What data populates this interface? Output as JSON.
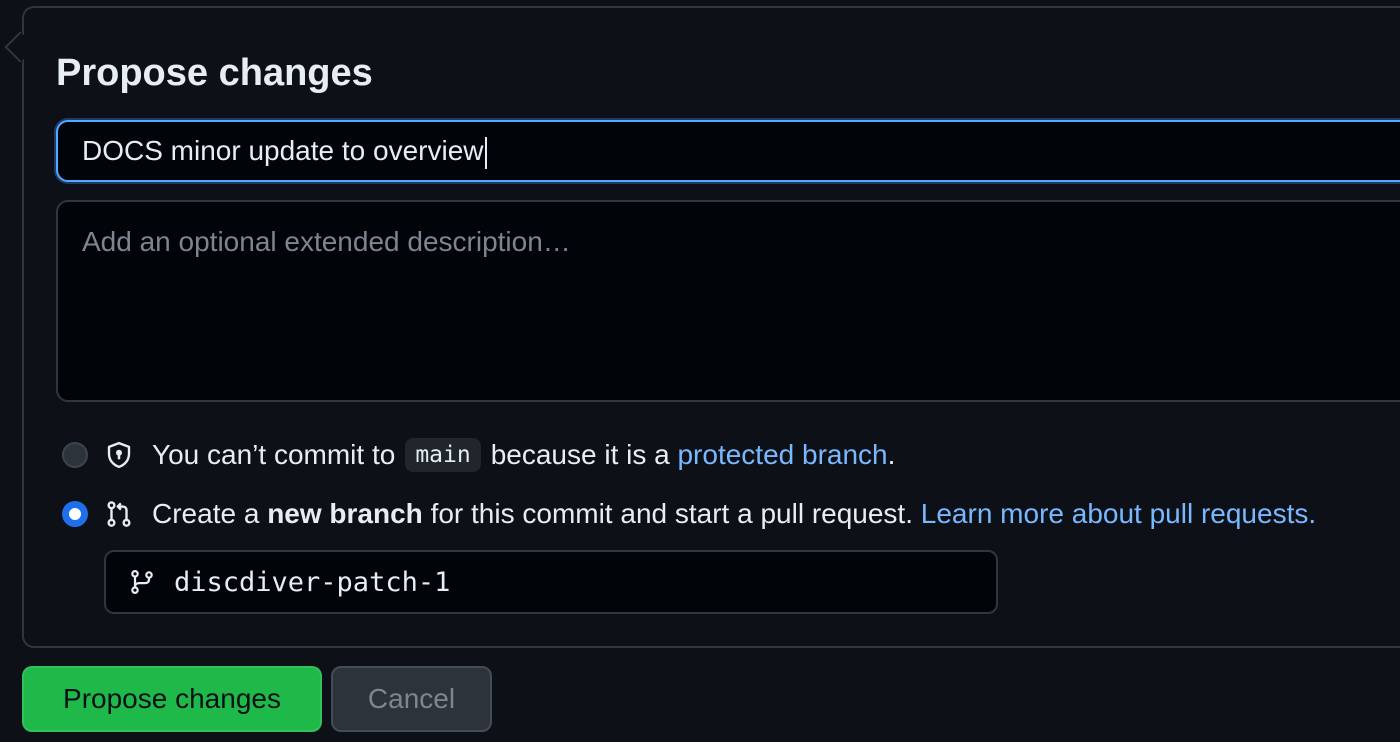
{
  "title": "Propose changes",
  "summary_input": {
    "value": "DOCS minor update to overview"
  },
  "description_input": {
    "placeholder": "Add an optional extended description…"
  },
  "options": {
    "direct_commit": {
      "text_before": "You can’t commit to",
      "branch": "main",
      "text_after": "because it is a",
      "link": "protected branch",
      "end": ".",
      "icon": "shield-lock-icon",
      "selected": false,
      "disabled": true
    },
    "new_branch": {
      "text_before": "Create a",
      "bold": "new branch",
      "text_after": "for this commit and start a pull request.",
      "link": "Learn more about pull requests.",
      "icon": "git-pull-request-icon",
      "selected": true
    }
  },
  "branch_name_input": {
    "value": "discdiver-patch-1",
    "icon": "git-branch-icon"
  },
  "buttons": {
    "propose": "Propose changes",
    "cancel": "Cancel"
  },
  "colors": {
    "background": "#0d1117",
    "border": "#30363d",
    "focus_border": "#58a6ff",
    "link": "#79b8ff",
    "primary_button": "#1fb94a",
    "radio_checked": "#1f6feb"
  }
}
